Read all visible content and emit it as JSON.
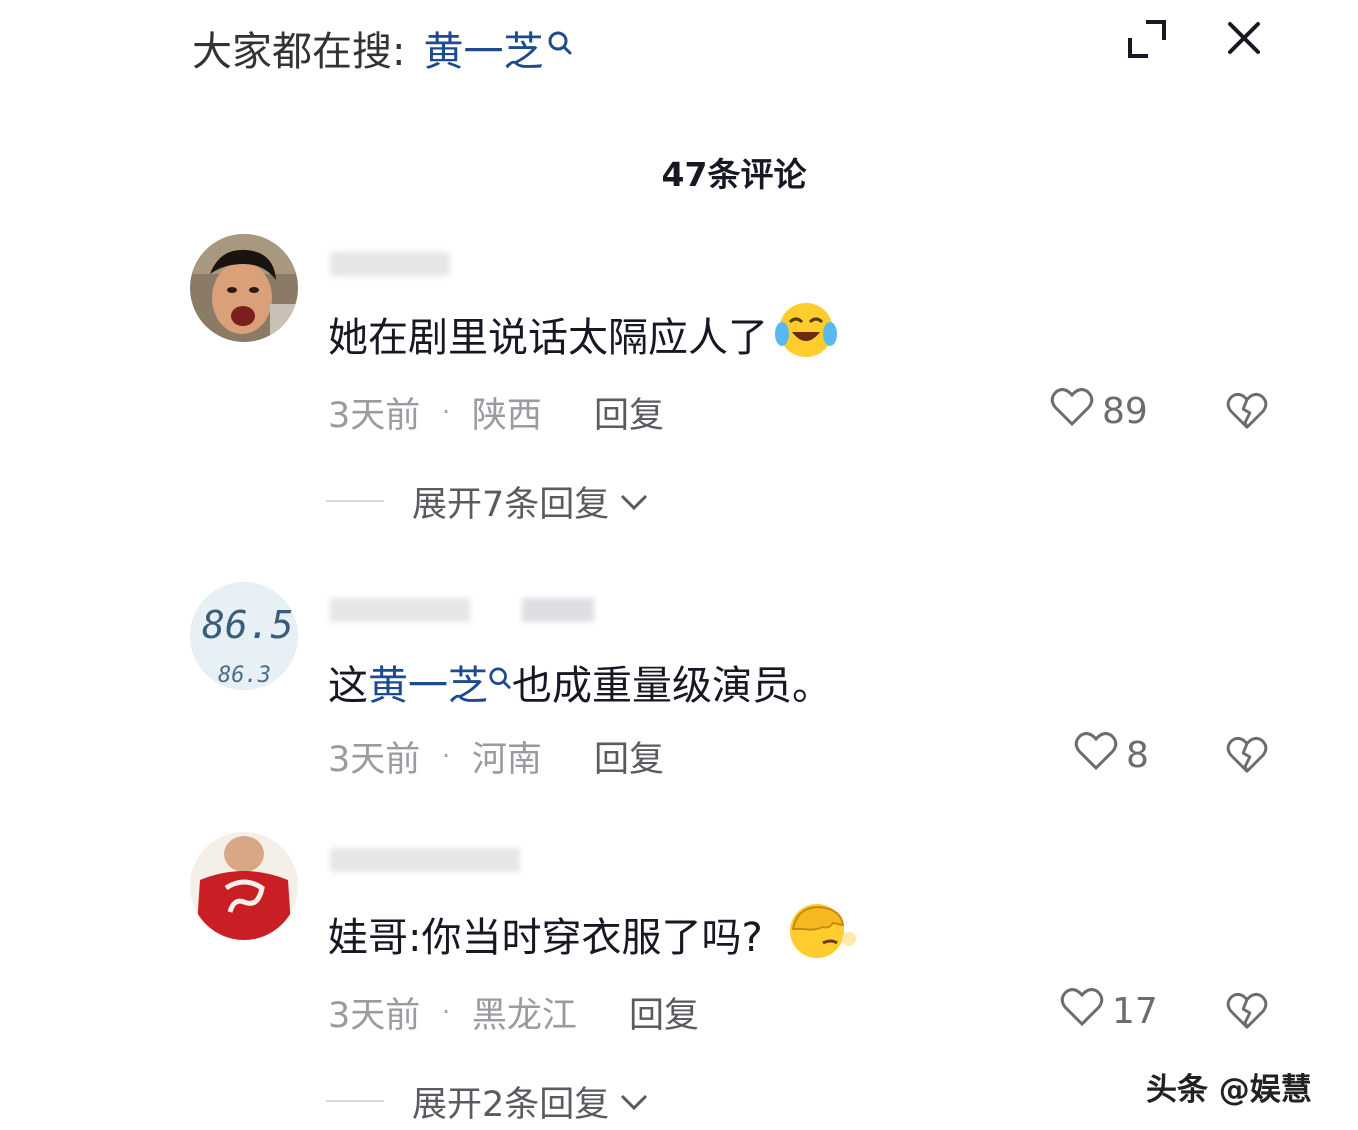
{
  "header": {
    "search_label": "大家都在搜:",
    "search_term": "黄一芝"
  },
  "comment_count": "47条评论",
  "comments": [
    {
      "text": "她在剧里说话太隔应人了",
      "time": "3天前",
      "region": "陕西",
      "reply": "回复",
      "likes": "89",
      "expand": "展开7条回复",
      "emoji": "laugh-cry-emoji"
    },
    {
      "text_pre": "这",
      "text_highlight": "黄一芝",
      "text_post": "也成重量级演员。",
      "time": "3天前",
      "region": "河南",
      "reply": "回复",
      "likes": "8"
    },
    {
      "text": "娃哥:你当时穿衣服了吗?",
      "time": "3天前",
      "region": "黑龙江",
      "reply": "回复",
      "likes": "17",
      "expand": "展开2条回复",
      "emoji": "facepalm-emoji"
    }
  ],
  "avatar2_digits": [
    "86.5",
    "86.3"
  ],
  "watermark": "头条 @娱慧",
  "colors": {
    "highlight": "#1d4b8f",
    "meta": "#9a9aa0",
    "text": "#161823"
  }
}
